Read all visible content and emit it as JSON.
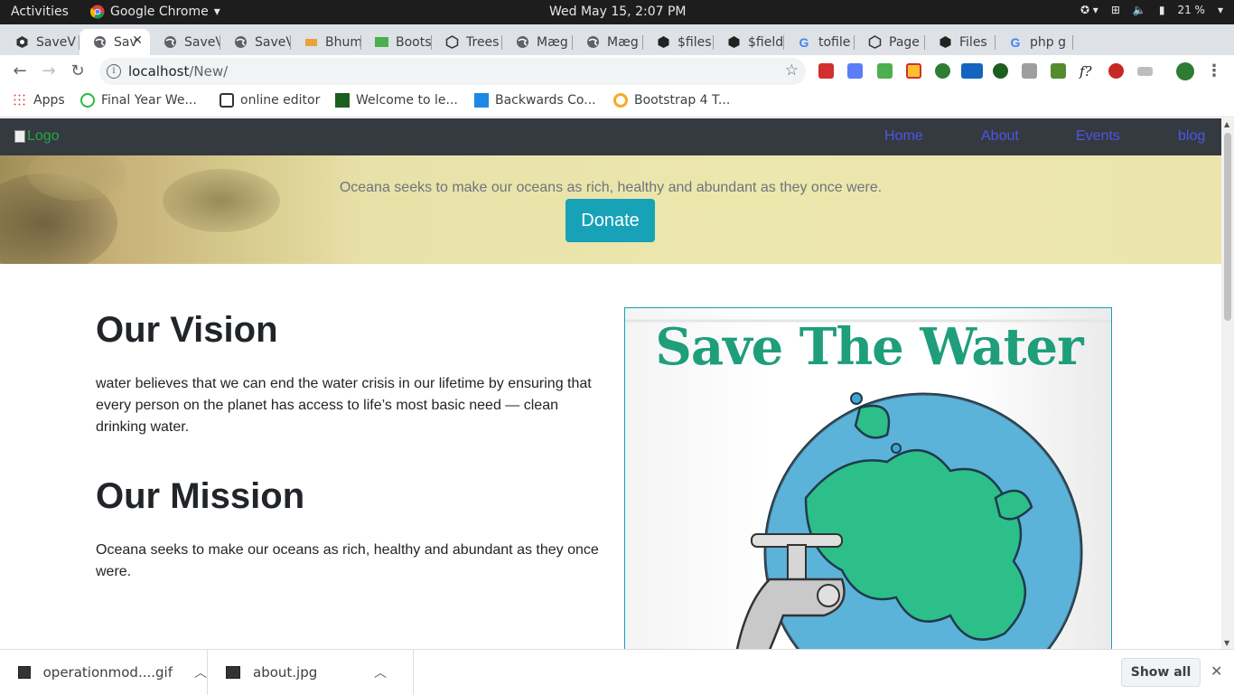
{
  "os": {
    "activities": "Activities",
    "app_name": "Google Chrome",
    "clock": "Wed May 15,  2:07 PM",
    "battery": "21 %"
  },
  "tabs": [
    {
      "label": "SaveV"
    },
    {
      "label": "Sav"
    },
    {
      "label": "SaveV"
    },
    {
      "label": "SaveV"
    },
    {
      "label": "Bhum"
    },
    {
      "label": "Boots"
    },
    {
      "label": "Trees"
    },
    {
      "label": "Mæg"
    },
    {
      "label": "Mæg"
    },
    {
      "label": "$files"
    },
    {
      "label": "$field"
    },
    {
      "label": "tofile"
    },
    {
      "label": "Page"
    },
    {
      "label": "Files"
    },
    {
      "label": "php g"
    }
  ],
  "toolbar": {
    "url_host": "localhost",
    "url_path": "/New/"
  },
  "bookmarks": [
    {
      "label": "Apps"
    },
    {
      "label": "Final Year We..."
    },
    {
      "label": "online editor"
    },
    {
      "label": "Welcome to le..."
    },
    {
      "label": "Backwards Co..."
    },
    {
      "label": "Bootstrap 4 T..."
    }
  ],
  "site": {
    "logo_alt": "Logo",
    "nav": [
      {
        "label": "Home"
      },
      {
        "label": "About"
      },
      {
        "label": "Events"
      },
      {
        "label": "blog"
      }
    ],
    "hero_text": "Oceana seeks to make our oceans as rich, healthy and abundant as they once were.",
    "donate_label": "Donate",
    "vision_title": "Our Vision",
    "vision_text": "water believes that we can end the water crisis in our lifetime by ensuring that every person on the planet has access to life’s most basic need — clean drinking water.",
    "mission_title": "Our Mission",
    "mission_text": "Oceana seeks to make our oceans as rich, healthy and abundant as they once were.",
    "image_heading": "Save The Water"
  },
  "downloads": {
    "items": [
      {
        "label": "operationmod....gif"
      },
      {
        "label": "about.jpg"
      }
    ],
    "show_all": "Show all"
  },
  "colors": {
    "navbar": "#343a40",
    "nav_link": "#4e55e6",
    "donate": "#17a2b8",
    "logo_link": "#28a745"
  }
}
